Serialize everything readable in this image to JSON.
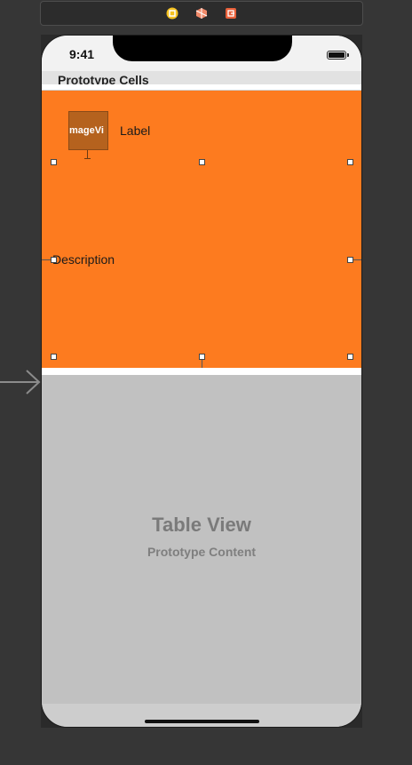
{
  "scene_dock": {
    "icons": [
      "view-controller-icon",
      "first-responder-icon",
      "exit-icon"
    ],
    "colors": {
      "controller": "#f5c220",
      "responder": "#f08a6a",
      "exit": "#e8603a"
    }
  },
  "status_bar": {
    "time": "9:41"
  },
  "section_header": {
    "title": "Prototype Cells"
  },
  "cell": {
    "image_view_label": "mageVi",
    "label": "Label",
    "description": "Description",
    "background_color": "#fd7b1f"
  },
  "table_view": {
    "title": "Table View",
    "subtitle": "Prototype Content"
  }
}
